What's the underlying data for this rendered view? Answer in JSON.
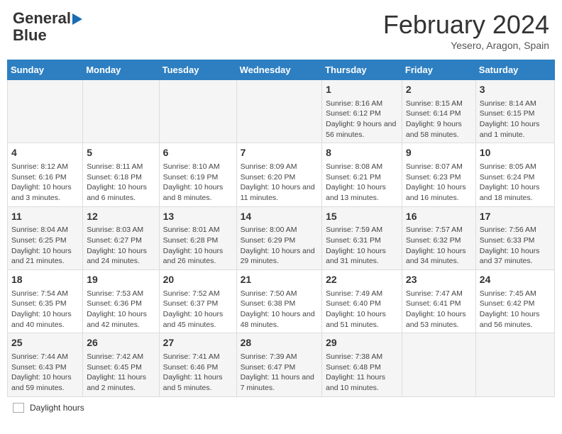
{
  "header": {
    "logo_line1": "General",
    "logo_line2": "Blue",
    "main_title": "February 2024",
    "subtitle": "Yesero, Aragon, Spain"
  },
  "days_of_week": [
    "Sunday",
    "Monday",
    "Tuesday",
    "Wednesday",
    "Thursday",
    "Friday",
    "Saturday"
  ],
  "weeks": [
    [
      {
        "day": "",
        "info": ""
      },
      {
        "day": "",
        "info": ""
      },
      {
        "day": "",
        "info": ""
      },
      {
        "day": "",
        "info": ""
      },
      {
        "day": "1",
        "info": "Sunrise: 8:16 AM\nSunset: 6:12 PM\nDaylight: 9 hours and 56 minutes."
      },
      {
        "day": "2",
        "info": "Sunrise: 8:15 AM\nSunset: 6:14 PM\nDaylight: 9 hours and 58 minutes."
      },
      {
        "day": "3",
        "info": "Sunrise: 8:14 AM\nSunset: 6:15 PM\nDaylight: 10 hours and 1 minute."
      }
    ],
    [
      {
        "day": "4",
        "info": "Sunrise: 8:12 AM\nSunset: 6:16 PM\nDaylight: 10 hours and 3 minutes."
      },
      {
        "day": "5",
        "info": "Sunrise: 8:11 AM\nSunset: 6:18 PM\nDaylight: 10 hours and 6 minutes."
      },
      {
        "day": "6",
        "info": "Sunrise: 8:10 AM\nSunset: 6:19 PM\nDaylight: 10 hours and 8 minutes."
      },
      {
        "day": "7",
        "info": "Sunrise: 8:09 AM\nSunset: 6:20 PM\nDaylight: 10 hours and 11 minutes."
      },
      {
        "day": "8",
        "info": "Sunrise: 8:08 AM\nSunset: 6:21 PM\nDaylight: 10 hours and 13 minutes."
      },
      {
        "day": "9",
        "info": "Sunrise: 8:07 AM\nSunset: 6:23 PM\nDaylight: 10 hours and 16 minutes."
      },
      {
        "day": "10",
        "info": "Sunrise: 8:05 AM\nSunset: 6:24 PM\nDaylight: 10 hours and 18 minutes."
      }
    ],
    [
      {
        "day": "11",
        "info": "Sunrise: 8:04 AM\nSunset: 6:25 PM\nDaylight: 10 hours and 21 minutes."
      },
      {
        "day": "12",
        "info": "Sunrise: 8:03 AM\nSunset: 6:27 PM\nDaylight: 10 hours and 24 minutes."
      },
      {
        "day": "13",
        "info": "Sunrise: 8:01 AM\nSunset: 6:28 PM\nDaylight: 10 hours and 26 minutes."
      },
      {
        "day": "14",
        "info": "Sunrise: 8:00 AM\nSunset: 6:29 PM\nDaylight: 10 hours and 29 minutes."
      },
      {
        "day": "15",
        "info": "Sunrise: 7:59 AM\nSunset: 6:31 PM\nDaylight: 10 hours and 31 minutes."
      },
      {
        "day": "16",
        "info": "Sunrise: 7:57 AM\nSunset: 6:32 PM\nDaylight: 10 hours and 34 minutes."
      },
      {
        "day": "17",
        "info": "Sunrise: 7:56 AM\nSunset: 6:33 PM\nDaylight: 10 hours and 37 minutes."
      }
    ],
    [
      {
        "day": "18",
        "info": "Sunrise: 7:54 AM\nSunset: 6:35 PM\nDaylight: 10 hours and 40 minutes."
      },
      {
        "day": "19",
        "info": "Sunrise: 7:53 AM\nSunset: 6:36 PM\nDaylight: 10 hours and 42 minutes."
      },
      {
        "day": "20",
        "info": "Sunrise: 7:52 AM\nSunset: 6:37 PM\nDaylight: 10 hours and 45 minutes."
      },
      {
        "day": "21",
        "info": "Sunrise: 7:50 AM\nSunset: 6:38 PM\nDaylight: 10 hours and 48 minutes."
      },
      {
        "day": "22",
        "info": "Sunrise: 7:49 AM\nSunset: 6:40 PM\nDaylight: 10 hours and 51 minutes."
      },
      {
        "day": "23",
        "info": "Sunrise: 7:47 AM\nSunset: 6:41 PM\nDaylight: 10 hours and 53 minutes."
      },
      {
        "day": "24",
        "info": "Sunrise: 7:45 AM\nSunset: 6:42 PM\nDaylight: 10 hours and 56 minutes."
      }
    ],
    [
      {
        "day": "25",
        "info": "Sunrise: 7:44 AM\nSunset: 6:43 PM\nDaylight: 10 hours and 59 minutes."
      },
      {
        "day": "26",
        "info": "Sunrise: 7:42 AM\nSunset: 6:45 PM\nDaylight: 11 hours and 2 minutes."
      },
      {
        "day": "27",
        "info": "Sunrise: 7:41 AM\nSunset: 6:46 PM\nDaylight: 11 hours and 5 minutes."
      },
      {
        "day": "28",
        "info": "Sunrise: 7:39 AM\nSunset: 6:47 PM\nDaylight: 11 hours and 7 minutes."
      },
      {
        "day": "29",
        "info": "Sunrise: 7:38 AM\nSunset: 6:48 PM\nDaylight: 11 hours and 10 minutes."
      },
      {
        "day": "",
        "info": ""
      },
      {
        "day": "",
        "info": ""
      }
    ]
  ],
  "footer": {
    "daylight_label": "Daylight hours"
  }
}
